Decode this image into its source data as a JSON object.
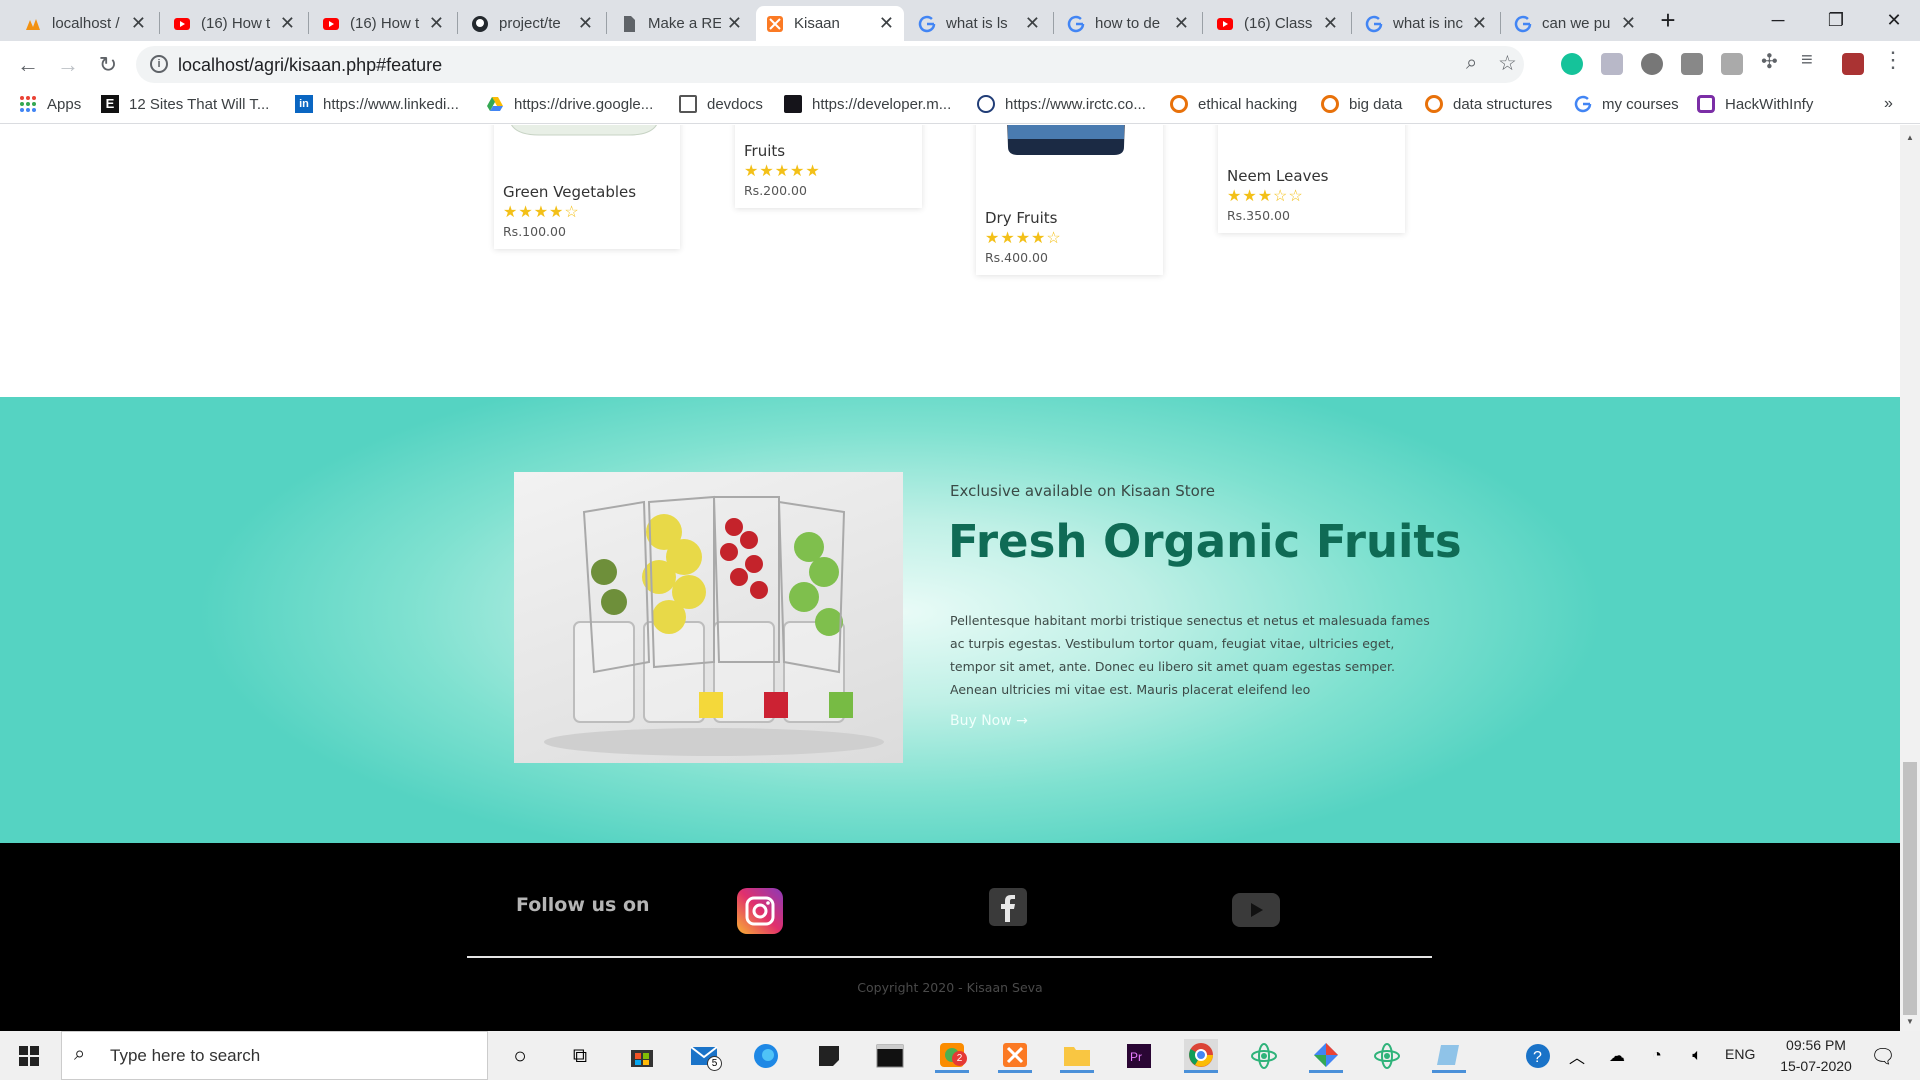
{
  "browser": {
    "tabs": [
      {
        "title": "localhost /",
        "icon": "phpmyadmin-icon"
      },
      {
        "title": "(16) How t",
        "icon": "youtube-icon"
      },
      {
        "title": "(16) How t",
        "icon": "youtube-icon"
      },
      {
        "title": "project/te",
        "icon": "github-icon"
      },
      {
        "title": "Make a RE",
        "icon": "document-icon"
      },
      {
        "title": "Kisaan",
        "icon": "kisaan-icon",
        "active": true
      },
      {
        "title": "what is ls",
        "icon": "google-icon"
      },
      {
        "title": "how to de",
        "icon": "google-icon"
      },
      {
        "title": "(16) Class",
        "icon": "youtube-icon"
      },
      {
        "title": "what is inc",
        "icon": "google-icon"
      },
      {
        "title": "can we pu",
        "icon": "google-icon"
      }
    ],
    "url": "localhost/agri/kisaan.php#feature",
    "bookmarks": [
      {
        "label": "Apps",
        "icon": "apps-grid-icon"
      },
      {
        "label": "12 Sites That Will T...",
        "icon": "e-icon"
      },
      {
        "label": "https://www.linkedi...",
        "icon": "linkedin-icon"
      },
      {
        "label": "https://drive.google...",
        "icon": "google-drive-icon"
      },
      {
        "label": "devdocs",
        "icon": "devdocs-icon"
      },
      {
        "label": "https://developer.m...",
        "icon": "mdn-icon"
      },
      {
        "label": "https://www.irctc.co...",
        "icon": "irctc-icon"
      },
      {
        "label": "ethical hacking",
        "icon": "bookmark-badge-icon"
      },
      {
        "label": "big data",
        "icon": "bookmark-badge-icon"
      },
      {
        "label": "data structures",
        "icon": "bookmark-badge-icon"
      },
      {
        "label": "my courses",
        "icon": "google-icon"
      },
      {
        "label": "HackWithInfy",
        "icon": "hackwithinfy-icon"
      }
    ]
  },
  "products": [
    {
      "name": "Green Vegetables",
      "rating": 4,
      "price": "Rs.100.00"
    },
    {
      "name": "Fruits",
      "rating": 5,
      "price": "Rs.200.00"
    },
    {
      "name": "Dry Fruits",
      "rating": 4,
      "price": "Rs.400.00"
    },
    {
      "name": "Neem Leaves",
      "rating": 3,
      "price": "Rs.350.00"
    }
  ],
  "promo": {
    "kicker": "Exclusive available on Kisaan Store",
    "title": "Fresh Organic Fruits",
    "body": "Pellentesque habitant morbi tristique senectus et netus et malesuada fames ac turpis egestas. Vestibulum tortor quam, feugiat vitae, ultricies eget, tempor sit amet, ante. Donec eu libero sit amet quam egestas semper. Aenean ultricies mi vitae est. Mauris placerat eleifend leo",
    "cta": "Buy Now →",
    "title_color": "#0f6b55"
  },
  "footer": {
    "follow": "Follow us on",
    "socials": [
      "instagram-icon",
      "facebook-icon",
      "youtube-icon"
    ],
    "copyright": "Copyright 2020 - Kisaan Seva"
  },
  "taskbar": {
    "search_placeholder": "Type here to search",
    "language": "ENG",
    "time": "09:56 PM",
    "date": "15-07-2020",
    "mail_badge": "5",
    "app_badge": "2"
  }
}
